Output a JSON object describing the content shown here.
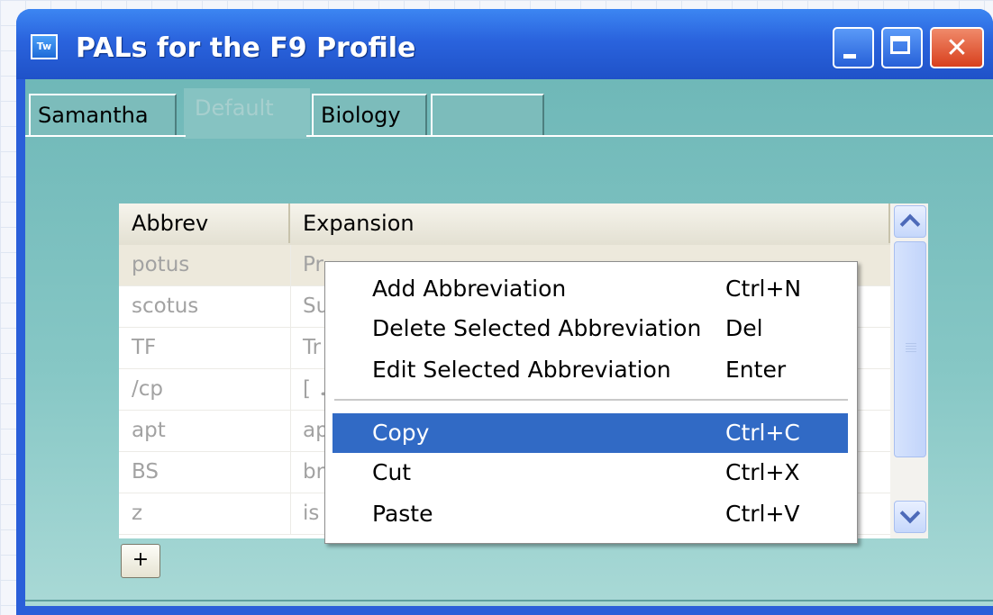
{
  "window": {
    "title": "PALs for the F9 Profile",
    "icon": "Tw"
  },
  "tabs": [
    "Samantha",
    "Default",
    "Biology",
    ""
  ],
  "list": {
    "columns": [
      "Abbrev",
      "Expansion"
    ],
    "rows": [
      {
        "abbrev": "potus",
        "expansion": "Pr"
      },
      {
        "abbrev": "scotus",
        "expansion": "Su"
      },
      {
        "abbrev": "TF",
        "expansion": "Tr"
      },
      {
        "abbrev": "/cp",
        "expansion": "[ ♫"
      },
      {
        "abbrev": "apt",
        "expansion": "ap"
      },
      {
        "abbrev": "BS",
        "expansion": "br"
      },
      {
        "abbrev": "z",
        "expansion": "is"
      }
    ]
  },
  "add_button": "+",
  "context_menu": {
    "items": [
      {
        "label": "Add Abbreviation",
        "shortcut": "Ctrl+N"
      },
      {
        "label": "Delete Selected Abbreviation",
        "shortcut": "Del"
      },
      {
        "label": "Edit Selected Abbreviation",
        "shortcut": "Enter"
      },
      {
        "label": "Copy",
        "shortcut": "Ctrl+C"
      },
      {
        "label": "Cut",
        "shortcut": "Ctrl+X"
      },
      {
        "label": "Paste",
        "shortcut": "Ctrl+V"
      }
    ]
  },
  "colors": {
    "titlebar": "#2a63dd",
    "client": "#86c7c5",
    "menu_highlight": "#316ac5"
  }
}
